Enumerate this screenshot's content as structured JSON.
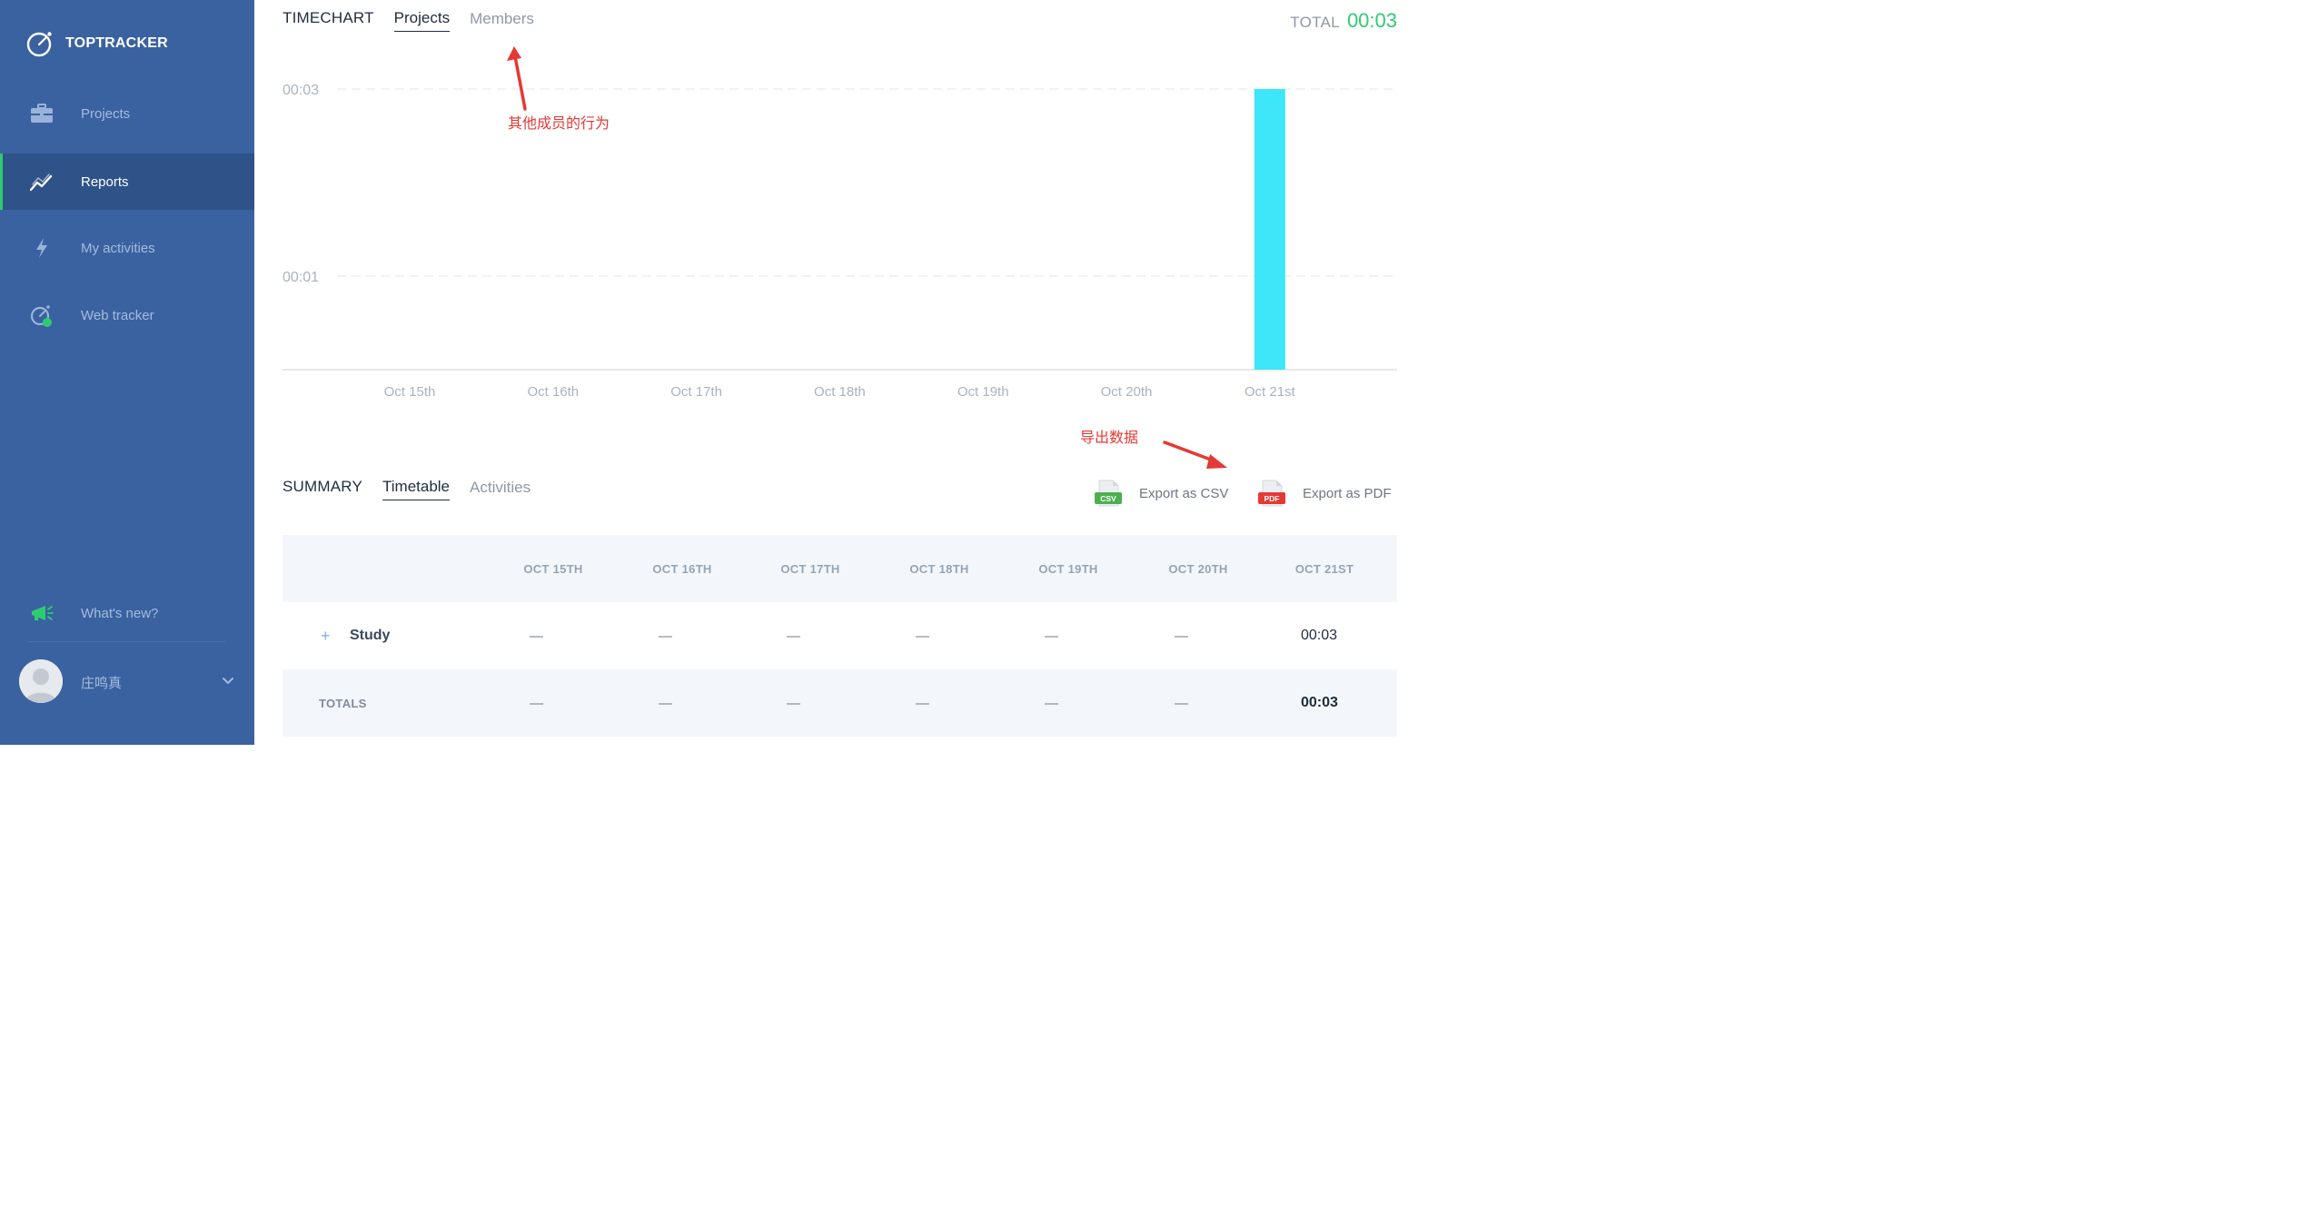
{
  "brand": {
    "name": "TOPTRACKER"
  },
  "sidebar": {
    "items": [
      {
        "label": "Projects",
        "icon": "briefcase-icon",
        "active": false
      },
      {
        "label": "Reports",
        "icon": "chart-line-icon",
        "active": true
      },
      {
        "label": "My activities",
        "icon": "lightning-icon",
        "active": false
      },
      {
        "label": "Web tracker",
        "icon": "stopwatch-icon",
        "active": false
      }
    ],
    "whats_new": {
      "label": "What's new?",
      "icon": "megaphone-icon"
    },
    "user": {
      "name": "庄鸣真"
    }
  },
  "timechart": {
    "title": "TIMECHART",
    "tabs": [
      {
        "label": "Projects",
        "active": true
      },
      {
        "label": "Members",
        "active": false
      }
    ],
    "total_label": "TOTAL",
    "total_value": "00:03"
  },
  "chart_data": {
    "type": "bar",
    "categories": [
      "Oct 15th",
      "Oct 16th",
      "Oct 17th",
      "Oct 18th",
      "Oct 19th",
      "Oct 20th",
      "Oct 21st"
    ],
    "values": [
      0,
      0,
      0,
      0,
      0,
      0,
      3
    ],
    "value_unit": "minutes",
    "y_ticks": [
      {
        "value": 3,
        "label": "00:03"
      },
      {
        "value": 1,
        "label": "00:01"
      }
    ],
    "ylim": [
      0,
      3
    ],
    "grid": "horizontal-dashed",
    "colors": {
      "bar": "#3ee6fa",
      "grid": "#e2e6ea",
      "axis": "#dcdfe3",
      "tick_text": "#a9b3be"
    }
  },
  "annotations": {
    "members_note": "其他成员的行为",
    "export_note": "导出数据",
    "color": "#e53935"
  },
  "summary": {
    "title": "SUMMARY",
    "tabs": [
      {
        "label": "Timetable",
        "active": true
      },
      {
        "label": "Activities",
        "active": false
      }
    ],
    "export_csv": {
      "label": "Export as CSV",
      "badge": "CSV",
      "color": "#4caf50"
    },
    "export_pdf": {
      "label": "Export as PDF",
      "badge": "PDF",
      "color": "#e53935"
    },
    "table": {
      "columns": [
        "OCT 15TH",
        "OCT 16TH",
        "OCT 17TH",
        "OCT 18TH",
        "OCT 19TH",
        "OCT 20TH",
        "OCT 21ST"
      ],
      "rows": [
        {
          "label": "Study",
          "values": [
            "—",
            "—",
            "—",
            "—",
            "—",
            "—",
            "00:03"
          ]
        }
      ],
      "totals": {
        "label": "TOTALS",
        "values": [
          "—",
          "—",
          "—",
          "—",
          "—",
          "—",
          "00:03"
        ]
      }
    }
  },
  "colors": {
    "sidebar": "#3a62a0",
    "sidebar_active": "#2f5289",
    "accent_green": "#2ecc71"
  }
}
